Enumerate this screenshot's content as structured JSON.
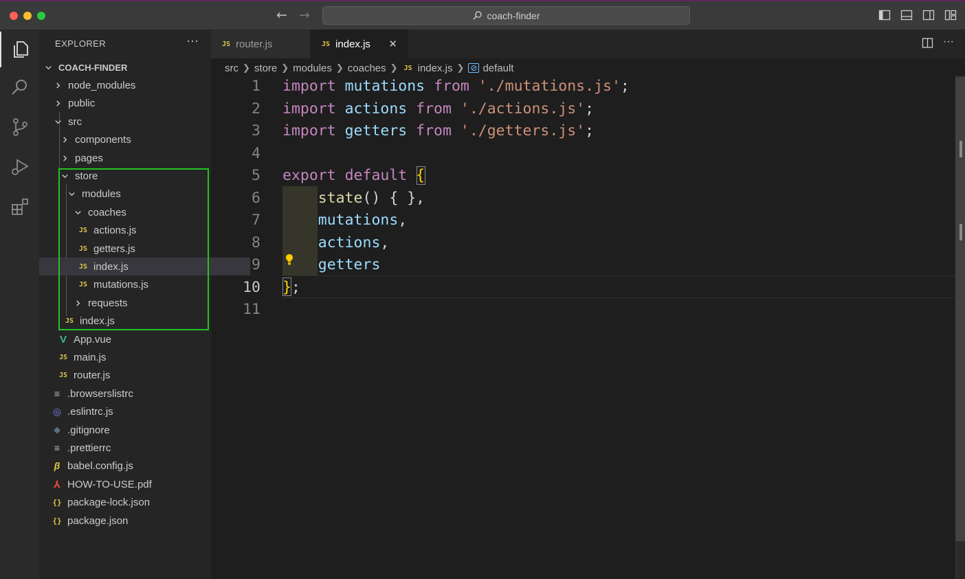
{
  "window": {
    "search_text": "coach-finder"
  },
  "explorer": {
    "title": "EXPLORER",
    "more": "···",
    "root": "COACH-FINDER",
    "items": [
      {
        "label": "node_modules"
      },
      {
        "label": "public"
      },
      {
        "label": "src"
      },
      {
        "label": "components"
      },
      {
        "label": "pages"
      },
      {
        "label": "store"
      },
      {
        "label": "modules"
      },
      {
        "label": "coaches"
      },
      {
        "label": "actions.js"
      },
      {
        "label": "getters.js"
      },
      {
        "label": "index.js"
      },
      {
        "label": "mutations.js"
      },
      {
        "label": "requests"
      },
      {
        "label": "index.js"
      },
      {
        "label": "App.vue"
      },
      {
        "label": "main.js"
      },
      {
        "label": "router.js"
      },
      {
        "label": ".browserslistrc"
      },
      {
        "label": ".eslintrc.js"
      },
      {
        "label": ".gitignore"
      },
      {
        "label": ".prettierrc"
      },
      {
        "label": "babel.config.js"
      },
      {
        "label": "HOW-TO-USE.pdf"
      },
      {
        "label": "package-lock.json"
      },
      {
        "label": "package.json"
      }
    ]
  },
  "tabs": [
    {
      "label": "router.js",
      "icon": "JS"
    },
    {
      "label": "index.js",
      "icon": "JS",
      "close": "✕"
    }
  ],
  "breadcrumb": {
    "parts": [
      "src",
      "store",
      "modules",
      "coaches",
      "index.js",
      "default"
    ],
    "file_icon": "JS"
  },
  "editor": {
    "current_line": 10,
    "lines": [
      {
        "n": "1",
        "t": [
          [
            "kw",
            "import "
          ],
          [
            "var",
            "mutations "
          ],
          [
            "kw",
            "from "
          ],
          [
            "str",
            "'./mutations.js'"
          ],
          [
            "plain",
            ";"
          ]
        ]
      },
      {
        "n": "2",
        "t": [
          [
            "kw",
            "import "
          ],
          [
            "var",
            "actions "
          ],
          [
            "kw",
            "from "
          ],
          [
            "str",
            "'./actions.js'"
          ],
          [
            "plain",
            ";"
          ]
        ]
      },
      {
        "n": "3",
        "t": [
          [
            "kw",
            "import "
          ],
          [
            "var",
            "getters "
          ],
          [
            "kw",
            "from "
          ],
          [
            "str",
            "'./getters.js'"
          ],
          [
            "plain",
            ";"
          ]
        ]
      },
      {
        "n": "4",
        "t": []
      },
      {
        "n": "5",
        "t": [
          [
            "kw",
            "export default "
          ],
          [
            "brace",
            "{"
          ]
        ]
      },
      {
        "n": "6",
        "t": [
          [
            "plain",
            "    "
          ],
          [
            "fn",
            "state"
          ],
          [
            "plain",
            "() { },"
          ]
        ]
      },
      {
        "n": "7",
        "t": [
          [
            "plain",
            "    "
          ],
          [
            "var",
            "mutations"
          ],
          [
            "plain",
            ","
          ]
        ]
      },
      {
        "n": "8",
        "t": [
          [
            "plain",
            "    "
          ],
          [
            "var",
            "actions"
          ],
          [
            "plain",
            ","
          ]
        ]
      },
      {
        "n": "9",
        "t": [
          [
            "plain",
            "    "
          ],
          [
            "var",
            "getters"
          ]
        ]
      },
      {
        "n": "10",
        "t": [
          [
            "brace",
            "}"
          ],
          [
            "plain",
            ";"
          ]
        ]
      },
      {
        "n": "11",
        "t": []
      }
    ]
  }
}
